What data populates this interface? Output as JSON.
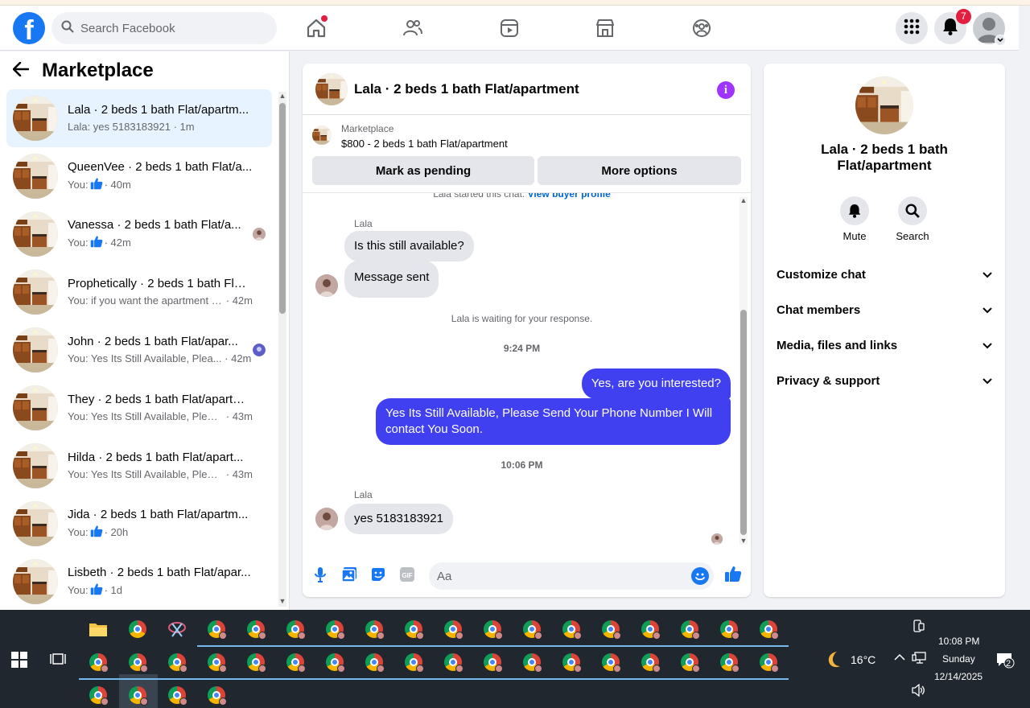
{
  "nav": {
    "logo": "f",
    "search_placeholder": "Search Facebook",
    "notifications_count": "7"
  },
  "left": {
    "title": "Marketplace",
    "conversations": [
      {
        "title": "Lala · 2 beds 1 bath Flat/apartm...",
        "preview": "Lala: yes 5183183921",
        "time": "· 1m",
        "active": true,
        "like": false
      },
      {
        "title": "QueenVee · 2 beds 1 bath Flat/a...",
        "preview": "You:",
        "time": "· 40m",
        "like": true
      },
      {
        "title": "Vanessa · 2 beds 1 bath Flat/a...",
        "preview": "You:",
        "time": "· 42m",
        "like": true
      },
      {
        "title": "Prophetically · 2 beds 1 bath Flat...",
        "preview": "You: if you want the apartment le...",
        "time": "· 42m",
        "like": false
      },
      {
        "title": "John · 2 beds 1 bath Flat/apar...",
        "preview": "You: Yes Its Still Available, Plea...",
        "time": "· 42m",
        "like": false
      },
      {
        "title": "They · 2 beds 1 bath Flat/apartm...",
        "preview": "You: Yes Its Still Available, Please ...",
        "time": "· 43m",
        "like": false
      },
      {
        "title": "Hilda · 2 beds 1 bath Flat/apart...",
        "preview": "You: Yes Its Still Available, Please ...",
        "time": "· 43m",
        "like": false
      },
      {
        "title": "Jida · 2 beds 1 bath Flat/apartm...",
        "preview": "You:",
        "time": "· 20h",
        "like": true
      },
      {
        "title": "Lisbeth · 2 beds 1 bath Flat/apar...",
        "preview": "You:",
        "time": "· 1d",
        "like": true
      }
    ]
  },
  "chat": {
    "title": "Lala · 2 beds 1 bath Flat/apartment",
    "marketplace_label": "Marketplace",
    "listing": "$800 - 2 beds 1 bath Flat/apartment",
    "mark_pending": "Mark as pending",
    "more_options": "More options",
    "started": "Lala started this chat.",
    "view_profile": "View buyer profile",
    "sender_name": "Lala",
    "msg1": "Is this still available?",
    "msg2": "Message sent",
    "waiting": "Lala is waiting for your response.",
    "time1": "9:24 PM",
    "out1": "Yes, are you interested?",
    "out2": "Yes Its Still Available, Please Send Your Phone Number I Will contact You Soon.",
    "time2": "10:06 PM",
    "msg3": "yes 5183183921",
    "composer_placeholder": "Aa"
  },
  "right": {
    "title": "Lala · 2 beds 1 bath Flat/apartment",
    "mute": "Mute",
    "search": "Search",
    "rows": [
      "Customize chat",
      "Chat members",
      "Media, files and links",
      "Privacy & support"
    ]
  },
  "taskbar": {
    "temperature": "16°C",
    "time": "10:08 PM",
    "day": "Sunday",
    "date": "12/14/2025",
    "notif_count": "2"
  },
  "colors": {
    "brand": "#1877f2",
    "outgoing_bubble": "#4040f0",
    "active_conv": "#e7f3ff",
    "info": "#a033ff"
  }
}
